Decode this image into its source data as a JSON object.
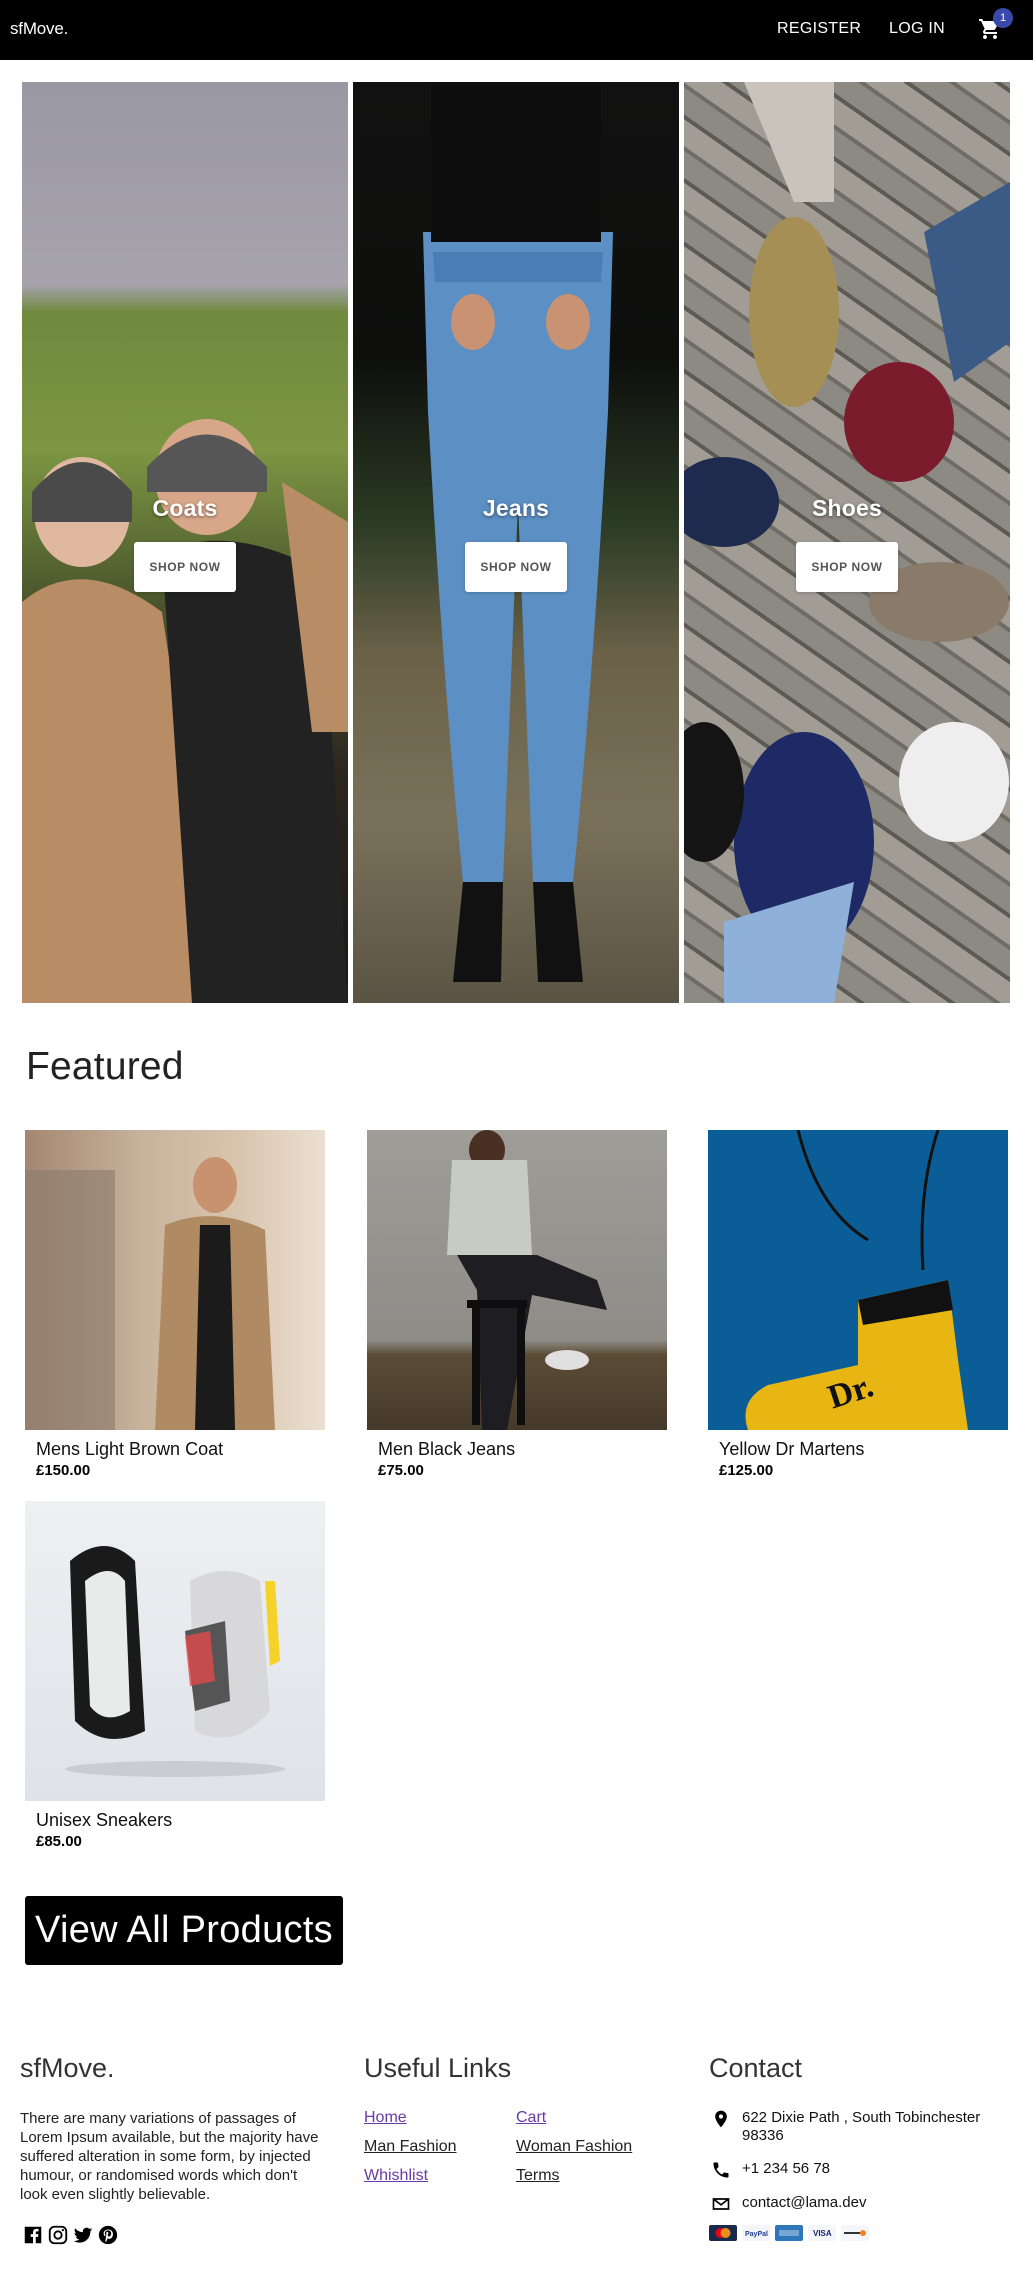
{
  "navbar": {
    "brand": "sfMove.",
    "register_label": "REGISTER",
    "login_label": "LOG IN",
    "cart_count": "1"
  },
  "categories": [
    {
      "title": "Coats",
      "button": "SHOP NOW"
    },
    {
      "title": "Jeans",
      "button": "SHOP NOW"
    },
    {
      "title": "Shoes",
      "button": "SHOP NOW"
    }
  ],
  "featured": {
    "title": "Featured",
    "products": [
      {
        "name": "Mens Light Brown Coat",
        "price": "£150.00"
      },
      {
        "name": "Men Black Jeans",
        "price": "£75.00"
      },
      {
        "name": "Yellow Dr Martens",
        "price": "£125.00"
      },
      {
        "name": "Unisex Sneakers",
        "price": "£85.00"
      }
    ],
    "view_all_label": "View All Products"
  },
  "footer": {
    "brand": "sfMove.",
    "description": "There are many variations of passages of Lorem Ipsum available, but the majority have suffered alteration in some form, by injected humour, or randomised words which don't look even slightly believable.",
    "useful_links_title": "Useful Links",
    "links": [
      "Home",
      "Cart",
      "Man Fashion",
      "Woman Fashion",
      "Whishlist",
      "Terms"
    ],
    "contact_title": "Contact",
    "address": "622 Dixie Path , South Tobinchester 98336",
    "phone": "+1 234 56 78",
    "email": "contact@lama.dev",
    "payment_methods": [
      "mastercard",
      "paypal",
      "amex",
      "visa",
      "discover"
    ],
    "social_icons": [
      "facebook-icon",
      "instagram-icon",
      "twitter-icon",
      "pinterest-icon"
    ]
  },
  "colors": {
    "navbar_bg": "#000000",
    "badge": "#3949ab",
    "link_visited": "#6a3aa6"
  }
}
